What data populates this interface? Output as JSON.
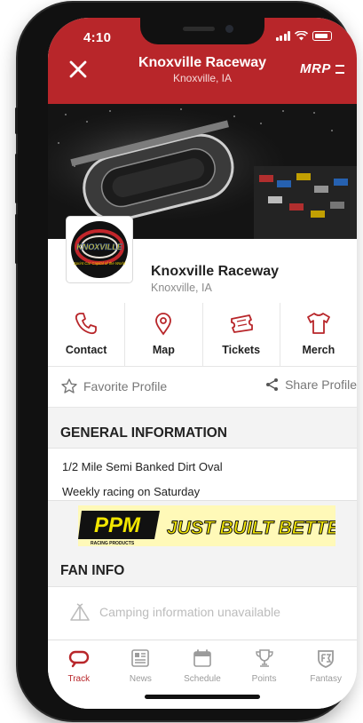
{
  "status": {
    "time": "4:10"
  },
  "header": {
    "title": "Knoxville Raceway",
    "subtitle": "Knoxville, IA",
    "brand": "MRP"
  },
  "profile": {
    "name": "Knoxville Raceway",
    "location": "Knoxville, IA",
    "logo_text": "KNOXVILLE",
    "logo_tagline": "Sprint Car Capital of the World"
  },
  "actions": [
    {
      "label": "Contact",
      "icon": "phone-icon"
    },
    {
      "label": "Map",
      "icon": "map-pin-icon"
    },
    {
      "label": "Tickets",
      "icon": "ticket-icon"
    },
    {
      "label": "Merch",
      "icon": "shirt-icon"
    }
  ],
  "favorite_label": "Favorite Profile",
  "share_label": "Share Profile",
  "general_info": {
    "heading": "GENERAL INFORMATION",
    "lines": [
      "1/2 Mile Semi Banked Dirt Oval",
      "Weekly racing on Saturday"
    ]
  },
  "ad": {
    "brand": "PPM",
    "tagline": "JUST BUILT BETTER",
    "subtext": "RACING PRODUCTS"
  },
  "fan_info": {
    "heading": "FAN INFO",
    "camping": "Camping information unavailable"
  },
  "tabs": [
    {
      "label": "Track",
      "icon": "track-icon",
      "active": true
    },
    {
      "label": "News",
      "icon": "news-icon",
      "active": false
    },
    {
      "label": "Schedule",
      "icon": "calendar-icon",
      "active": false
    },
    {
      "label": "Points",
      "icon": "trophy-icon",
      "active": false
    },
    {
      "label": "Fantasy",
      "icon": "fantasy-icon",
      "active": false
    }
  ],
  "colors": {
    "accent": "#b8262a",
    "ad_yellow": "#f2e600",
    "text": "#222222"
  }
}
